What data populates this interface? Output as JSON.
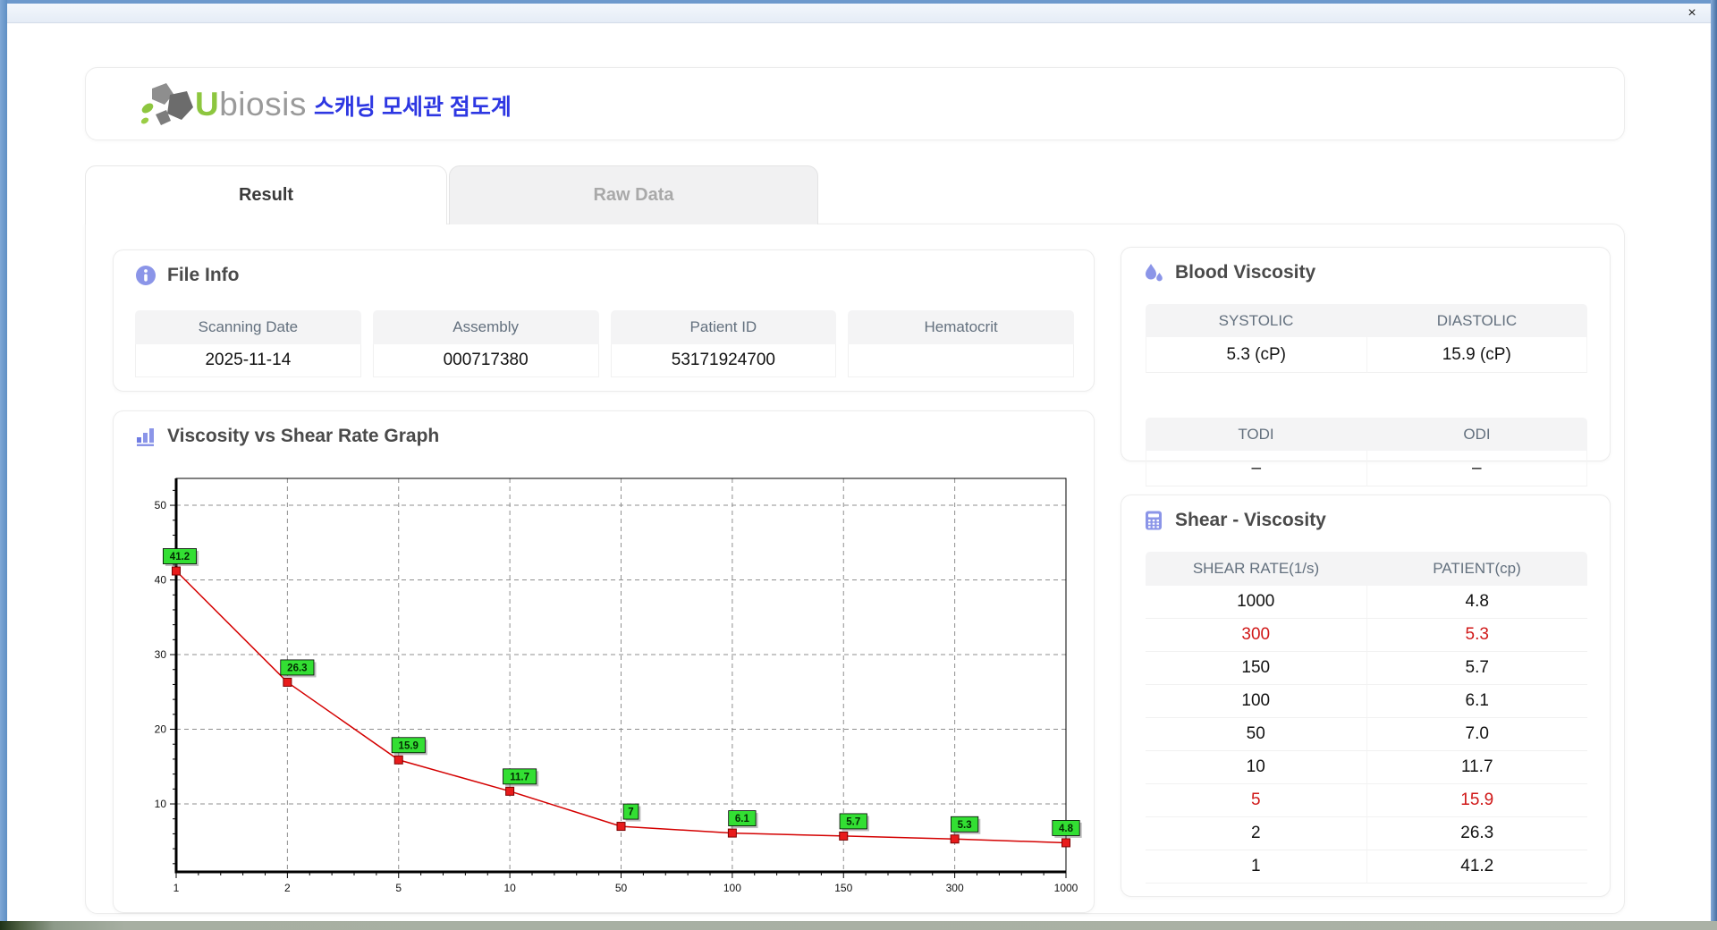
{
  "window": {
    "close_label": "×"
  },
  "header": {
    "brand_u": "U",
    "brand_rest": "biosis",
    "title_ko": "스캐닝 모세관 점도계"
  },
  "tabs": [
    {
      "label": "Result",
      "active": true
    },
    {
      "label": "Raw Data",
      "active": false
    }
  ],
  "file_info": {
    "title": "File Info",
    "fields": [
      {
        "label": "Scanning Date",
        "value": "2025-11-14"
      },
      {
        "label": "Assembly",
        "value": "000717380"
      },
      {
        "label": "Patient ID",
        "value": "53171924700"
      },
      {
        "label": "Hematocrit",
        "value": ""
      }
    ]
  },
  "blood_viscosity": {
    "title": "Blood Viscosity",
    "rows": [
      {
        "label_left": "SYSTOLIC",
        "value_left": "5.3 (cP)",
        "label_right": "DIASTOLIC",
        "value_right": "15.9 (cP)"
      },
      {
        "label_left": "TODI",
        "value_left": "–",
        "label_right": "ODI",
        "value_right": "–"
      }
    ]
  },
  "shear_viscosity": {
    "title": "Shear - Viscosity",
    "columns": [
      "SHEAR RATE(1/s)",
      "PATIENT(cp)"
    ],
    "rows": [
      {
        "shear": "1000",
        "patient": "4.8",
        "highlight": false
      },
      {
        "shear": "300",
        "patient": "5.3",
        "highlight": true
      },
      {
        "shear": "150",
        "patient": "5.7",
        "highlight": false
      },
      {
        "shear": "100",
        "patient": "6.1",
        "highlight": false
      },
      {
        "shear": "50",
        "patient": "7.0",
        "highlight": false
      },
      {
        "shear": "10",
        "patient": "11.7",
        "highlight": false
      },
      {
        "shear": "5",
        "patient": "15.9",
        "highlight": true
      },
      {
        "shear": "2",
        "patient": "26.3",
        "highlight": false
      },
      {
        "shear": "1",
        "patient": "41.2",
        "highlight": false
      }
    ]
  },
  "graph": {
    "title": "Viscosity vs Shear Rate Graph"
  },
  "chart_data": {
    "type": "line",
    "title": "Viscosity vs Shear Rate Graph",
    "categories": [
      "1",
      "2",
      "5",
      "10",
      "50",
      "100",
      "150",
      "300",
      "1000"
    ],
    "values": [
      41.2,
      26.3,
      15.9,
      11.7,
      7.0,
      6.1,
      5.7,
      5.3,
      4.8
    ],
    "point_labels": [
      "41.2",
      "26.3",
      "15.9",
      "11.7",
      "7",
      "6.1",
      "5.7",
      "5.3",
      "4.8"
    ],
    "xlabel": "",
    "ylabel": "",
    "y_ticks": [
      10,
      20,
      30,
      40,
      50
    ],
    "ylim": [
      0.9,
      53.6
    ],
    "x_axis_type": "equally-spaced-categories",
    "grid": true,
    "legend": "none",
    "line_color": "#d40000",
    "marker_color": "#e81b1b",
    "label_bg": "#33df33"
  },
  "colors": {
    "accent_icon": "#8b95e8",
    "highlight_red": "#d01818",
    "brand_green": "#8dc63f",
    "title_blue": "#2d37e2"
  }
}
